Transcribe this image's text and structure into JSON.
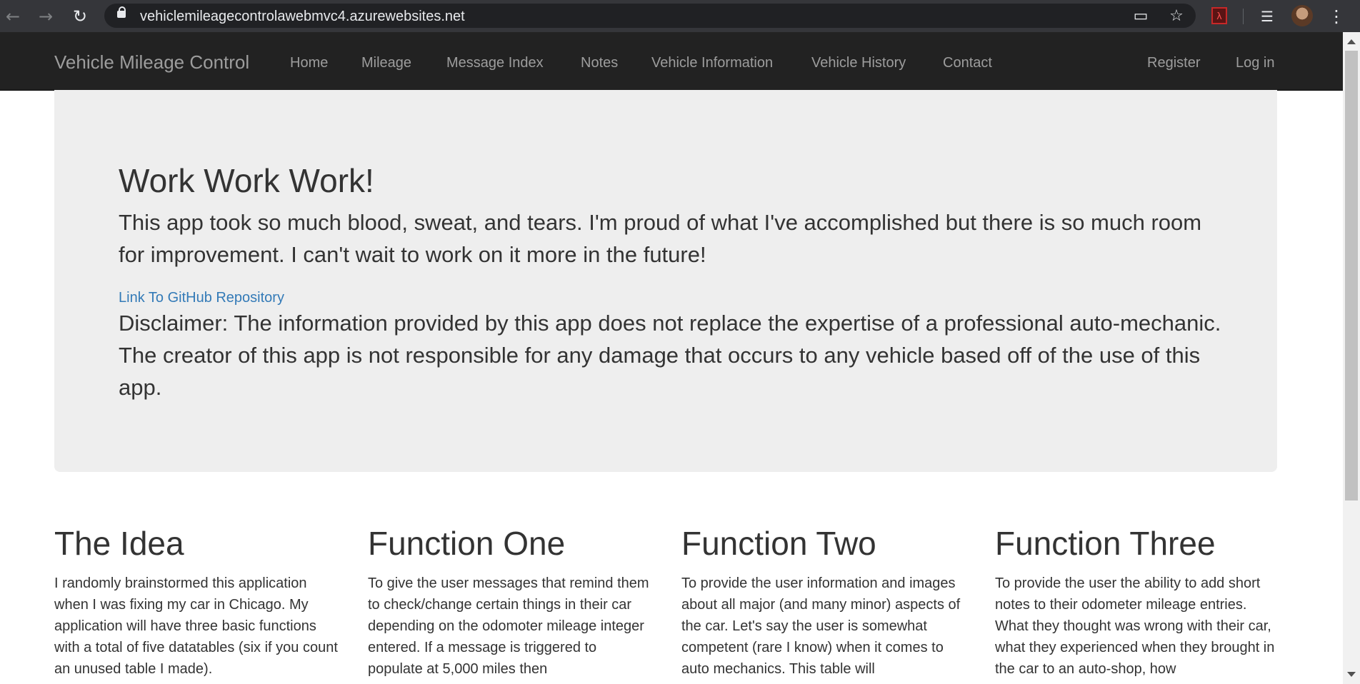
{
  "browser": {
    "url": "vehiclemileagecontrolawebmvc4.azurewebsites.net",
    "icons": {
      "back": "arrow-left-icon",
      "forward": "arrow-right-icon",
      "reload": "reload-icon",
      "lock": "lock-icon",
      "cast": "cast-icon",
      "bookmark": "star-icon",
      "pdf": "pdf-extension-icon",
      "media": "media-queue-icon",
      "profile": "avatar",
      "menu": "more-vertical-icon"
    }
  },
  "navbar": {
    "brand": "Vehicle Mileage Control",
    "links": [
      "Home",
      "Mileage",
      "Message Index",
      "Notes",
      "Vehicle Information",
      "Vehicle History",
      "Contact"
    ],
    "right_links": [
      "Register",
      "Log in"
    ]
  },
  "jumbotron": {
    "title": "Work Work Work!",
    "lead": "This app took so much blood, sweat, and tears. I'm proud of what I've accomplished but there is so much room for improvement. I can't wait to work on it more in the future!",
    "github_link": "Link To GitHub Repository",
    "disclaimer": "Disclaimer: The information provided by this app does not replace the expertise of a professional auto-mechanic. The creator of this app is not responsible for any damage that occurs to any vehicle based off of the use of this app."
  },
  "columns": [
    {
      "title": "The Idea",
      "text": "I randomly brainstormed this application when I was fixing my car in Chicago. My application will have three basic functions with a total of five datatables (six if you count an unused table I made)."
    },
    {
      "title": "Function One",
      "text": "To give the user messages that remind them to check/change certain things in their car depending on the odomoter mileage integer entered. If a message is triggered to populate at 5,000 miles then"
    },
    {
      "title": "Function Two",
      "text": "To provide the user information and images about all major (and many minor) aspects of the car. Let's say the user is somewhat competent (rare I know) when it comes to auto mechanics. This table will"
    },
    {
      "title": "Function Three",
      "text": "To provide the user the ability to add short notes to their odometer mileage entries. What they thought was wrong with their car, what they experienced when they brought in the car to an auto-shop, how"
    }
  ],
  "colors": {
    "navbar_bg": "#222222",
    "navbar_text": "#9d9d9d",
    "jumbotron_bg": "#eeeeee",
    "link": "#337ab7",
    "body_text": "#333333"
  }
}
